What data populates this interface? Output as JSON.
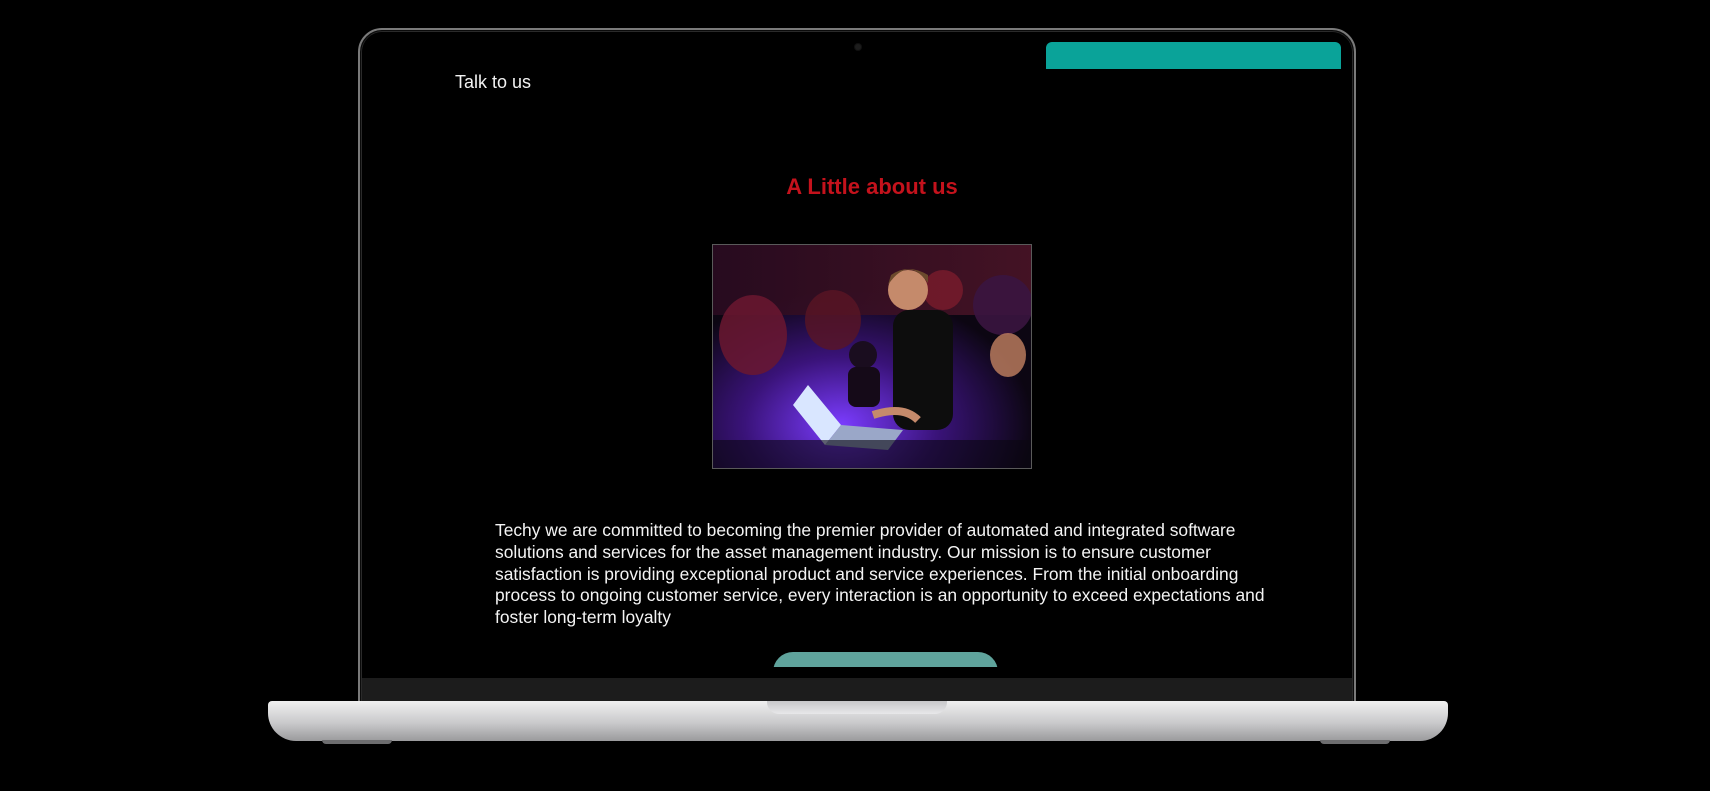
{
  "nav": {
    "talk_label": "Talk to us"
  },
  "about": {
    "title": "A Little about us",
    "body": "Techy we are committed to becoming the premier provider of automated and integrated software solutions and services for the asset management industry. Our mission is to ensure customer satisfaction is providing exceptional product and service experiences. From the initial onboarding process to ongoing customer service, every interaction is an opportunity to exceed expectations and foster long-term loyalty"
  },
  "colors": {
    "accent_teal": "#0aa399",
    "title_red": "#c4121c",
    "button_teal": "#5fa39c",
    "background": "#000000"
  }
}
